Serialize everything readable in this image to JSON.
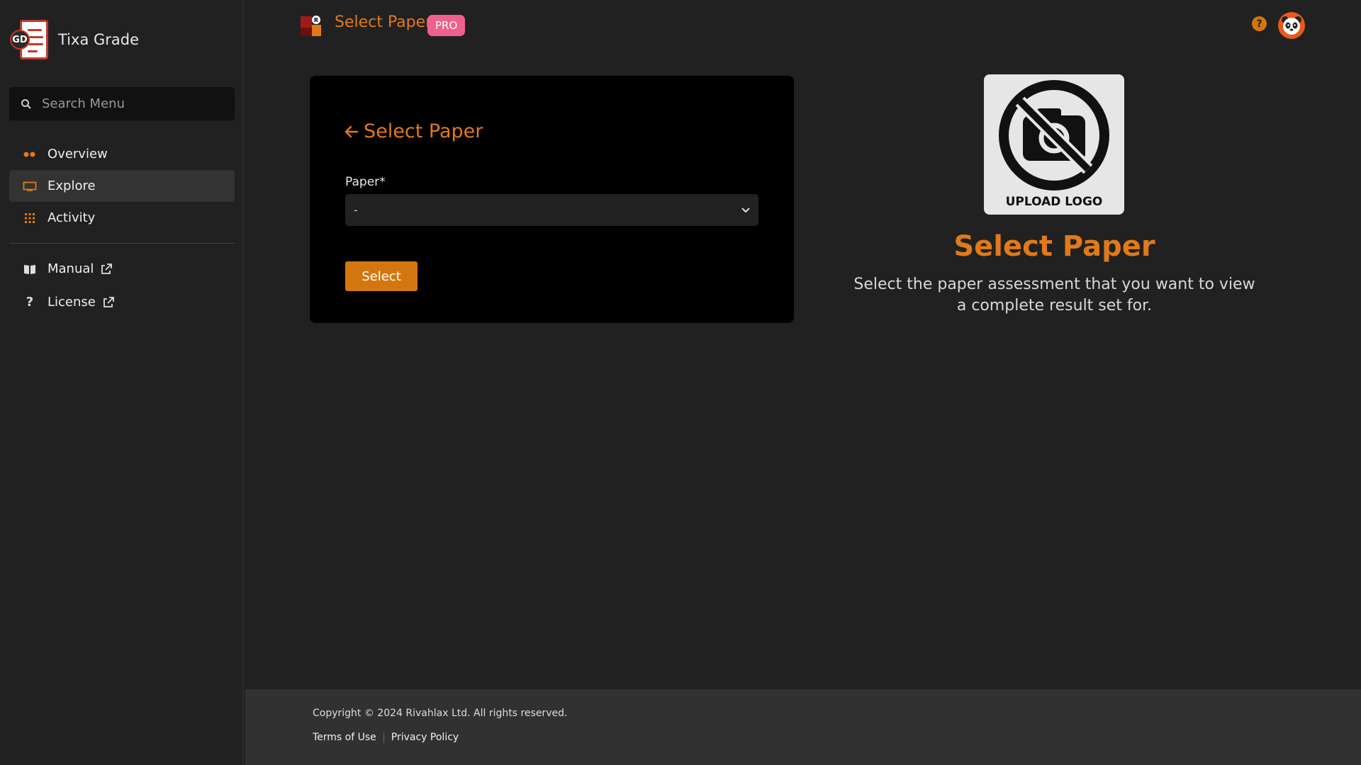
{
  "sidebar": {
    "brand": {
      "logo_text": "GD",
      "name": "Tixa Grade"
    },
    "search": {
      "placeholder": "Search Menu",
      "icon": "search-icon"
    },
    "items": [
      {
        "label": "Overview",
        "icon": "dots-icon",
        "active": false
      },
      {
        "label": "Explore",
        "icon": "monitor-icon",
        "active": true
      },
      {
        "label": "Activity",
        "icon": "grid-icon",
        "active": false
      }
    ],
    "links": [
      {
        "label": "Manual",
        "icon": "book-icon",
        "external": true
      },
      {
        "label": "License",
        "icon": "question-icon",
        "external": true
      }
    ]
  },
  "topbar": {
    "title": "Select Paper",
    "badge": "PRO",
    "help_icon": "?"
  },
  "form": {
    "title": "Select Paper",
    "paper_label": "Paper*",
    "paper_value": "-",
    "submit_label": "Select"
  },
  "panel": {
    "logo_text": "UPLOAD LOGO",
    "title": "Select Paper",
    "description": "Select the paper assessment that you want to view a complete result set for."
  },
  "footer": {
    "copyright": "Copyright © 2024 Rivahlax Ltd. All rights reserved.",
    "terms": "Terms of Use",
    "privacy": "Privacy Policy"
  },
  "colors": {
    "accent": "#e07a1a",
    "button": "#d4760f",
    "badge": "#f0608e",
    "background": "#212121",
    "card": "#000000"
  }
}
